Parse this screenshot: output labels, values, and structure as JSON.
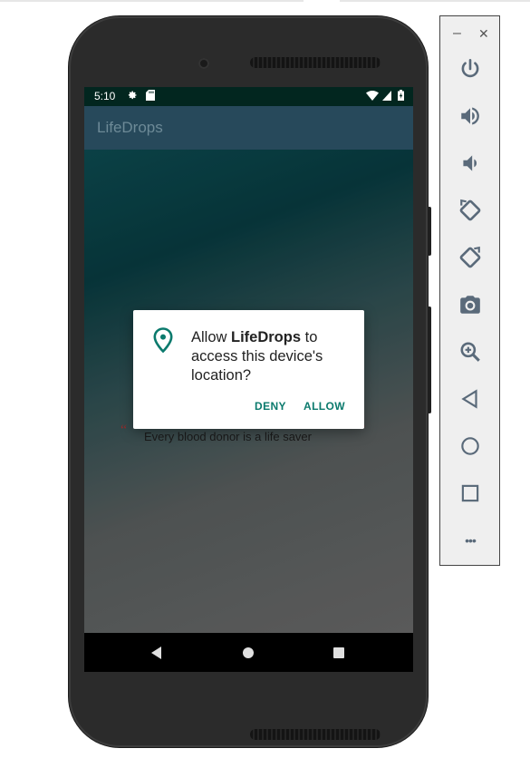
{
  "status_bar": {
    "time": "5:10"
  },
  "app": {
    "title": "LifeDrops"
  },
  "quote": {
    "open_mark": "“",
    "close_mark": "”",
    "text": "Every blood donor is a life saver"
  },
  "dialog": {
    "message_prefix": "Allow ",
    "app_name": "LifeDrops",
    "message_suffix": " to access this device's location?",
    "deny_label": "DENY",
    "allow_label": "ALLOW"
  },
  "emulator_toolbar": {
    "minimize_label": "–",
    "close_label": "✕",
    "more_label": "•••",
    "buttons": [
      "power-icon",
      "volume-up-icon",
      "volume-down-icon",
      "rotate-left-icon",
      "rotate-right-icon",
      "screenshot-camera-icon",
      "zoom-icon",
      "back-icon",
      "home-icon",
      "overview-icon",
      "more-icon"
    ]
  },
  "colors": {
    "status_bar": "#02261f",
    "app_bar": "#27495b",
    "dialog_button": "#0b7a6d",
    "quote_mark": "#8f2c2c",
    "toolbar_icon": "#5a6a7a"
  }
}
